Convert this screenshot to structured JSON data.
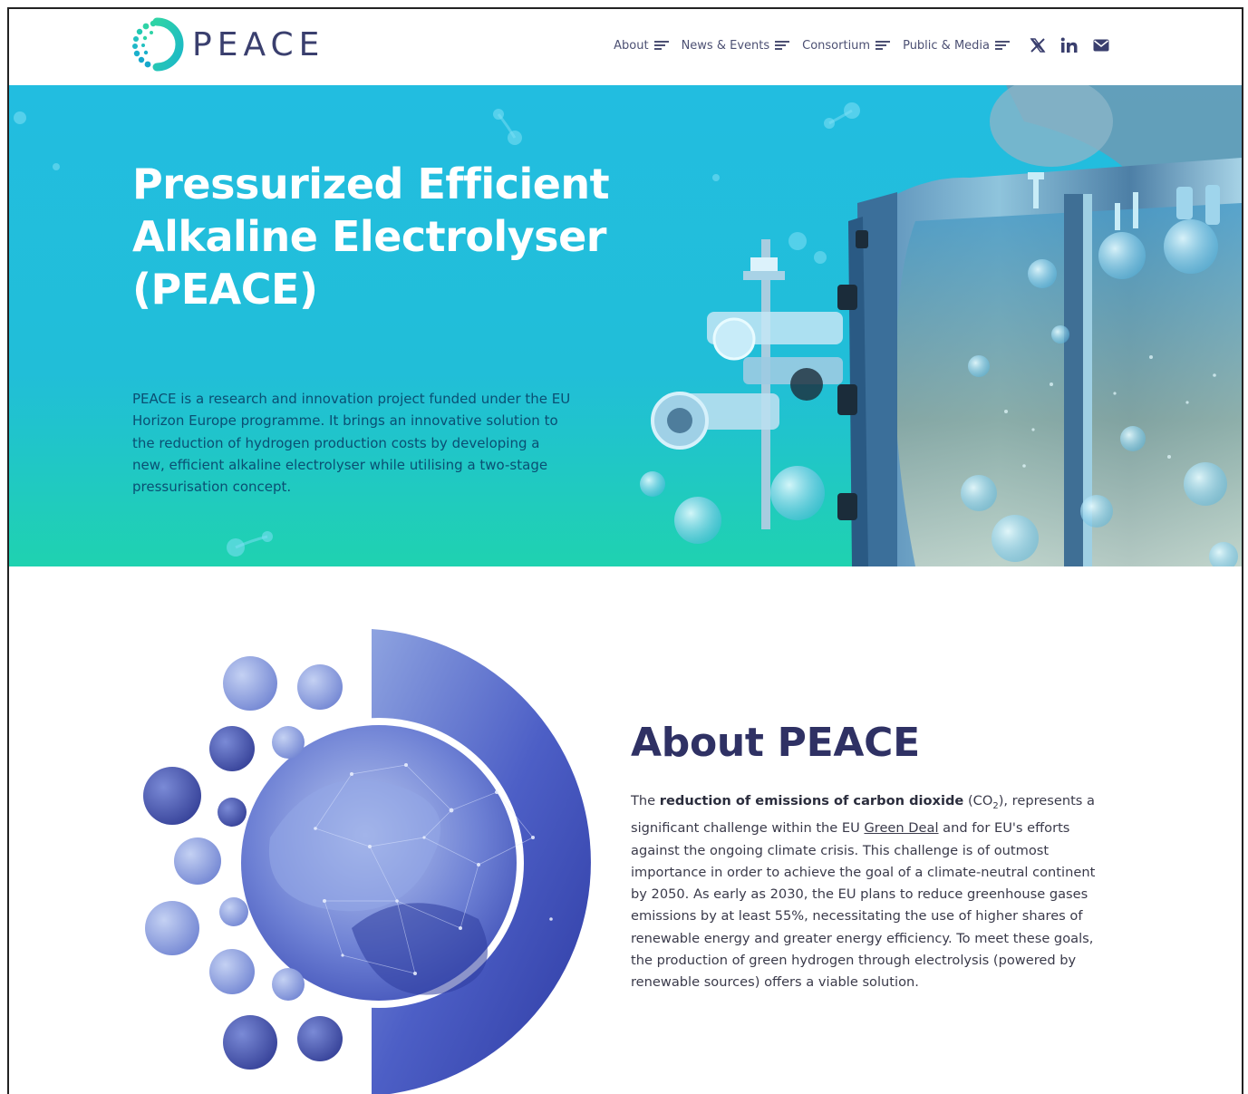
{
  "header": {
    "logo_text": "PEACE",
    "nav": [
      {
        "label": "About"
      },
      {
        "label": "News & Events"
      },
      {
        "label": "Consortium"
      },
      {
        "label": "Public & Media"
      }
    ],
    "social": [
      "x-icon",
      "linkedin-icon",
      "mail-icon"
    ]
  },
  "hero": {
    "title": "Pressurized Efficient Alkaline Electrolyser (PEACE)",
    "description": "PEACE is a research and innovation project funded under the EU Horizon Europe programme. It brings an innovative solution to the reduction of hydrogen production costs by developing a new, efficient alkaline electrolyser while utilising a two-stage pressurisation concept."
  },
  "about": {
    "title": "About PEACE",
    "p_intro": "The ",
    "p_bold": "reduction of emissions of carbon dioxide",
    "p_co2_open": " (CO",
    "p_co2_sub": "2",
    "p_co2_close": "), represents a significant challenge within the EU ",
    "p_link": "Green Deal",
    "p_rest": " and for EU's efforts against the ongoing climate crisis. This challenge is of outmost importance in order to achieve the goal of a climate-neutral continent by 2050. As early as 2030, the EU plans to reduce greenhouse gases emissions by at least 55%, necessitating the use of higher shares of renewable energy and greater energy efficiency. To meet these goals, the production of green hydrogen through electrolysis (powered by renewable sources) offers a viable solution."
  },
  "colors": {
    "brand_navy": "#3a3f6e",
    "hero_cyan": "#22bde0",
    "hero_green": "#1fd2b0",
    "about_blue": "#4a5cc0"
  }
}
